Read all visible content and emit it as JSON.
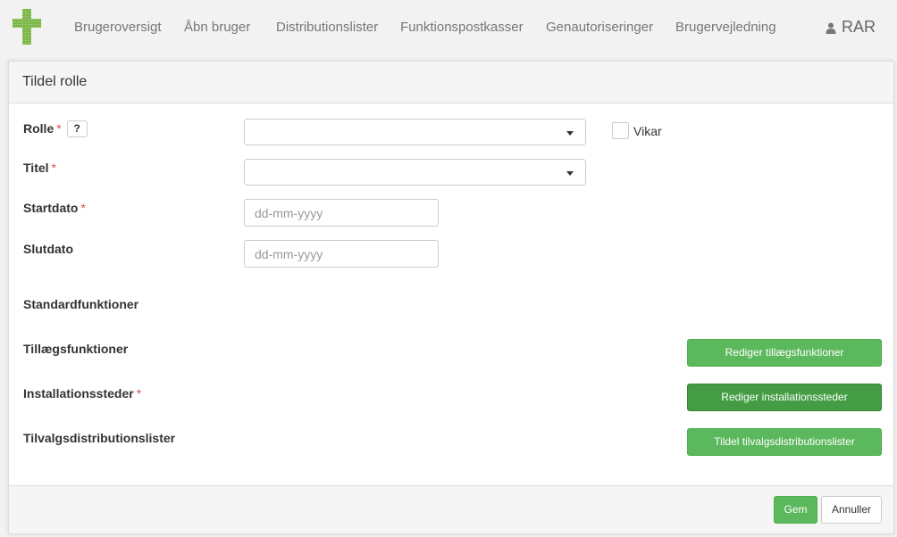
{
  "nav": {
    "items": [
      {
        "label": "Brugeroversigt"
      },
      {
        "label": "Åbn bruger"
      },
      {
        "label": "Distributionslister"
      },
      {
        "label": "Funktionspostkasser"
      },
      {
        "label": "Genautoriseringer"
      },
      {
        "label": "Brugervejledning"
      }
    ],
    "user": "RAR",
    "user_icon": "user-icon",
    "logo_icon": "green-cross-logo"
  },
  "panel": {
    "title": "Tildel rolle",
    "fields": {
      "rolle_label": "Rolle",
      "required_marker": "*",
      "help_label": "?",
      "vikar_label": "Vikar",
      "titel_label": "Titel",
      "startdato_label": "Startdato",
      "startdato_placeholder": "dd-mm-yyyy",
      "slutdato_label": "Slutdato",
      "slutdato_placeholder": "dd-mm-yyyy",
      "standardfunktioner_label": "Standardfunktioner",
      "tillaegsfunktioner_label": "Tillægsfunktioner",
      "installationssteder_label": "Installationssteder",
      "tilvalgsdistributionslister_label": "Tilvalgsdistributionslister"
    },
    "buttons": {
      "edit_tillaeg": "Rediger tillægsfunktioner",
      "edit_installation": "Rediger installationssteder",
      "assign_distribution": "Tildel tilvalgsdistributionslister",
      "save": "Gem",
      "cancel": "Annuller"
    }
  },
  "colors": {
    "accent_green": "#5cb85c",
    "accent_green_active": "#449d44",
    "required_red": "#d9534f"
  }
}
